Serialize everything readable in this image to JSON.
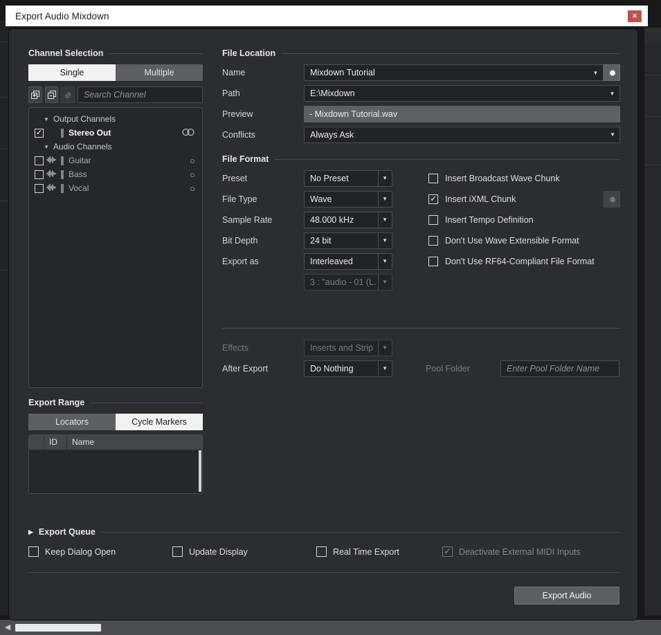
{
  "window": {
    "title": "Export Audio Mixdown",
    "close_label": "✕"
  },
  "channel_selection": {
    "heading": "Channel Selection",
    "mode_single": "Single",
    "mode_multiple": "Multiple",
    "active_mode": "Single",
    "toolbar": {
      "expand_all_icon": "expand-all-icon",
      "collapse_all_icon": "collapse-all-icon",
      "link_icon": "link-icon"
    },
    "search_placeholder": "Search Channel",
    "search_value": "",
    "groups": [
      {
        "label": "Output Channels",
        "expanded": true,
        "channels": [
          {
            "name": "Stereo Out",
            "checked": true,
            "bold": true,
            "has_waveform": false,
            "routing": "stereo"
          }
        ]
      },
      {
        "label": "Audio Channels",
        "expanded": true,
        "channels": [
          {
            "name": "Guitar",
            "checked": false,
            "bold": false,
            "has_waveform": true,
            "routing": "mono"
          },
          {
            "name": "Bass",
            "checked": false,
            "bold": false,
            "has_waveform": true,
            "routing": "mono"
          },
          {
            "name": "Vocal",
            "checked": false,
            "bold": false,
            "has_waveform": true,
            "routing": "mono"
          }
        ]
      }
    ]
  },
  "export_range": {
    "heading": "Export Range",
    "tab_locators": "Locators",
    "tab_cycle_markers": "Cycle Markers",
    "active_tab": "Cycle Markers",
    "columns": [
      "",
      "ID",
      "Name"
    ],
    "rows": []
  },
  "file_location": {
    "heading": "File Location",
    "name_label": "Name",
    "name_value": "Mixdown Tutorial",
    "path_label": "Path",
    "path_value": "E:\\Mixdown",
    "preview_label": "Preview",
    "preview_value": "- Mixdown Tutorial.wav",
    "conflicts_label": "Conflicts",
    "conflicts_value": "Always Ask",
    "name_settings_icon": "gear-icon",
    "dropdown_icon": "chevron-down-icon"
  },
  "file_format": {
    "heading": "File Format",
    "preset_label": "Preset",
    "preset_value": "No Preset",
    "file_type_label": "File Type",
    "file_type_value": "Wave",
    "sample_rate_label": "Sample Rate",
    "sample_rate_value": "48.000 kHz",
    "bit_depth_label": "Bit Depth",
    "bit_depth_value": "24 bit",
    "export_as_label": "Export as",
    "export_as_value": "Interleaved",
    "channel_config_value": "3 : \"audio - 01 (L.",
    "channel_config_disabled": true,
    "settings_icon": "gear-icon",
    "options": [
      {
        "label": "Insert Broadcast Wave Chunk",
        "checked": false
      },
      {
        "label": "Insert iXML Chunk",
        "checked": true
      },
      {
        "label": "Insert Tempo Definition",
        "checked": false
      },
      {
        "label": "Don't Use Wave Extensible Format",
        "checked": false
      },
      {
        "label": "Don't Use RF64-Compliant File Format",
        "checked": false
      }
    ]
  },
  "post_process": {
    "effects_label": "Effects",
    "effects_value": "Inserts and Strip",
    "effects_disabled": true,
    "after_export_label": "After Export",
    "after_export_value": "Do Nothing",
    "pool_folder_label": "Pool Folder",
    "pool_folder_placeholder": "Enter Pool Folder Name",
    "pool_folder_value": ""
  },
  "export_queue": {
    "heading": "Export Queue",
    "expander_icon": "triangle-right-icon",
    "expanded": false,
    "options": [
      {
        "label": "Keep Dialog Open",
        "checked": false,
        "disabled": false
      },
      {
        "label": "Update Display",
        "checked": false,
        "disabled": false
      },
      {
        "label": "Real Time Export",
        "checked": false,
        "disabled": false
      },
      {
        "label": "Deactivate External MIDI Inputs",
        "checked": true,
        "disabled": true
      }
    ]
  },
  "footer": {
    "export_button": "Export Audio"
  },
  "colors": {
    "dialog_bg": "#2b2e31",
    "titlebar_bg": "#ffffff",
    "close_red": "#c0504a",
    "field_bg": "#212427",
    "accent_active": "#f2f2f0",
    "preview_bg": "#5d6165"
  }
}
